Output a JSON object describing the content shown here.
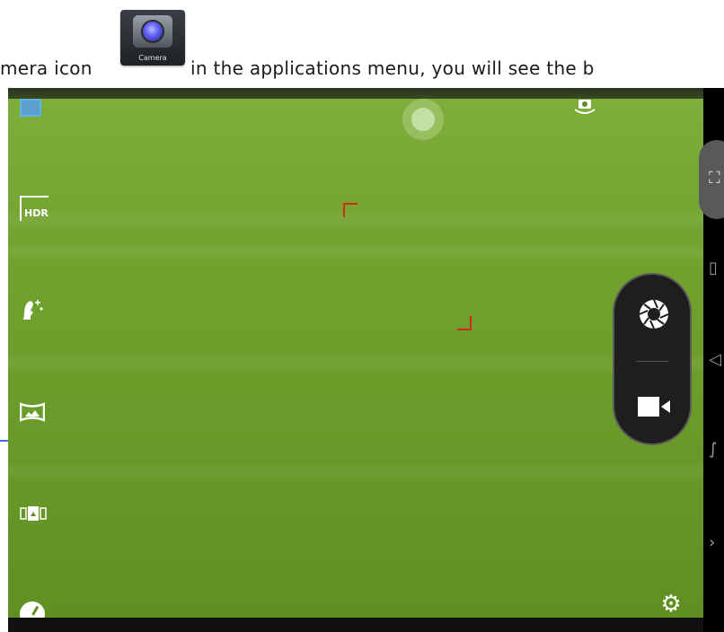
{
  "document": {
    "text_left": "mera icon",
    "text_right": "in the applications menu, you will see the b",
    "app_icon_caption": "Camera"
  },
  "camera": {
    "left_toolbar": [
      {
        "name": "gallery-thumbnail-icon"
      },
      {
        "name": "hdr-mode-icon",
        "label": "HDR"
      },
      {
        "name": "beauty-face-icon"
      },
      {
        "name": "panorama-mode-icon"
      },
      {
        "name": "burst-shot-icon"
      },
      {
        "name": "exposure-meter-icon"
      }
    ],
    "top_controls": [
      "zoom-joystick-icon",
      "switch-camera-icon"
    ],
    "capture_controls": [
      "shutter-button",
      "video-record-button"
    ],
    "settings_icon": "gear-icon",
    "right_nav_icons": [
      "screenshot-icon",
      "recent-apps-icon",
      "back-icon",
      "home-icon",
      "menu-expand-icon"
    ],
    "colors": {
      "viewfinder": "#72a22e",
      "focus_frame": "#d52a1a",
      "gallery_accent": "#5ab5e6"
    }
  }
}
